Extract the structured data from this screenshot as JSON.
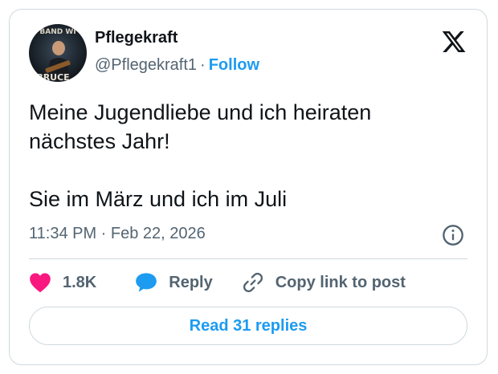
{
  "author": {
    "display_name": "Pflegekraft",
    "handle": "@Pflegekraft1",
    "separator": "·",
    "follow_label": "Follow",
    "avatar_text_top": "BAND WI",
    "avatar_text_bottom": "BRUCE"
  },
  "tweet": {
    "line1": "Meine Jugendliebe und ich heiraten",
    "line2": "nächstes Jahr!",
    "line3": "Sie im März und ich im Juli",
    "timestamp": "11:34 PM · Feb 22, 2026"
  },
  "actions": {
    "like_count": "1.8K",
    "reply_label": "Reply",
    "copy_label": "Copy link to post"
  },
  "read_replies_label": "Read 31 replies",
  "colors": {
    "accent": "#1d9bf0",
    "like": "#f91880",
    "text": "#0f1419",
    "muted": "#536471",
    "border": "#cfd9de"
  },
  "icons": [
    "x-logo-icon",
    "info-icon",
    "heart-icon",
    "reply-bubble-icon",
    "link-icon"
  ]
}
